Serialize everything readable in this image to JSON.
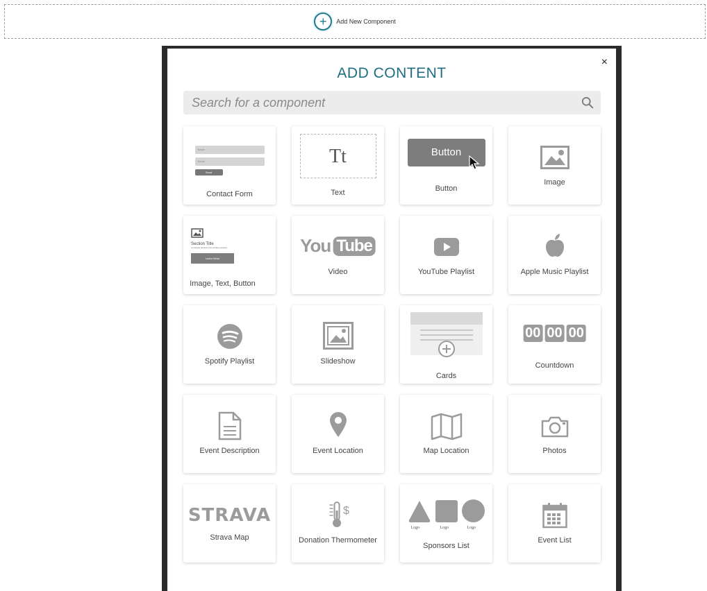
{
  "add_strip": {
    "label": "Add New Component",
    "plus": "+"
  },
  "modal": {
    "title": "ADD CONTENT",
    "close": "×",
    "search_placeholder": "Search for a component"
  },
  "components": [
    {
      "label": "Contact Form",
      "icon": "contact-form-preview-icon",
      "preview": {
        "name": "Name",
        "email": "Email",
        "send": "Send"
      }
    },
    {
      "label": "Text",
      "icon": "text-tt-icon",
      "glyph": "Tt"
    },
    {
      "label": "Button",
      "icon": "button-preview-icon",
      "glyph": "Button"
    },
    {
      "label": "Image",
      "icon": "image-icon"
    },
    {
      "label": "Image, Text, Button",
      "icon": "image-text-button-preview-icon",
      "preview": {
        "title": "Section Title",
        "body": "ut congue accsas eros a loiuer eamovs",
        "button": "Learn More"
      }
    },
    {
      "label": "Video",
      "icon": "youtube-logo-icon",
      "glyph_you": "You",
      "glyph_tube": "Tube"
    },
    {
      "label": "YouTube Playlist",
      "icon": "play-button-icon"
    },
    {
      "label": "Apple Music Playlist",
      "icon": "apple-logo-icon"
    },
    {
      "label": "Spotify Playlist",
      "icon": "spotify-logo-icon"
    },
    {
      "label": "Slideshow",
      "icon": "slideshow-icon"
    },
    {
      "label": "Cards",
      "icon": "cards-icon"
    },
    {
      "label": "Countdown",
      "icon": "countdown-icon",
      "digits": [
        "00",
        "00",
        "00"
      ]
    },
    {
      "label": "Event Description",
      "icon": "document-icon"
    },
    {
      "label": "Event Location",
      "icon": "map-pin-icon"
    },
    {
      "label": "Map Location",
      "icon": "folded-map-icon"
    },
    {
      "label": "Photos",
      "icon": "camera-icon"
    },
    {
      "label": "Strava Map",
      "icon": "strava-logo-icon",
      "glyph": "STRAVA"
    },
    {
      "label": "Donation Thermometer",
      "icon": "thermometer-dollar-icon",
      "glyph": "$"
    },
    {
      "label": "Sponsors List",
      "icon": "sponsor-logos-icon",
      "logos": [
        "Logo",
        "Logo",
        "Logo"
      ]
    },
    {
      "label": "Event List",
      "icon": "calendar-icon"
    }
  ],
  "colors": {
    "accent": "#1f6d80",
    "icon_gray": "#9b9b9b",
    "card_bg": "#ffffff",
    "search_bg": "#ececec"
  }
}
